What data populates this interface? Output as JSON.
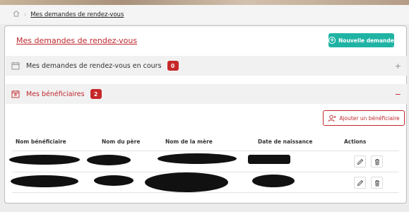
{
  "breadcrumb": {
    "current": "Mes demandes de rendez-vous"
  },
  "page": {
    "title": "Mes demandes de rendez-vous",
    "new_button_label": "Nouvelle demande"
  },
  "sections": {
    "demandes": {
      "label": "Mes demandes de rendez-vous en cours",
      "count": "0",
      "toggle": "+"
    },
    "beneficiaires": {
      "label": "Mes bénéficiaires",
      "count": "2",
      "toggle": "−"
    }
  },
  "beneficiaires": {
    "add_button_label": "Ajouter un bénéficiaire",
    "columns": [
      "Nom bénéficiaire",
      "Nom du père",
      "Nom de la mère",
      "Date de naissance",
      "Actions"
    ]
  },
  "colors": {
    "accent": "#c0282d",
    "primary": "#1fb3a4",
    "badge": "#c62828"
  },
  "icons": [
    "home-icon",
    "calendar-icon",
    "plus-circle-icon",
    "user-plus-icon",
    "edit-icon",
    "trash-icon"
  ]
}
